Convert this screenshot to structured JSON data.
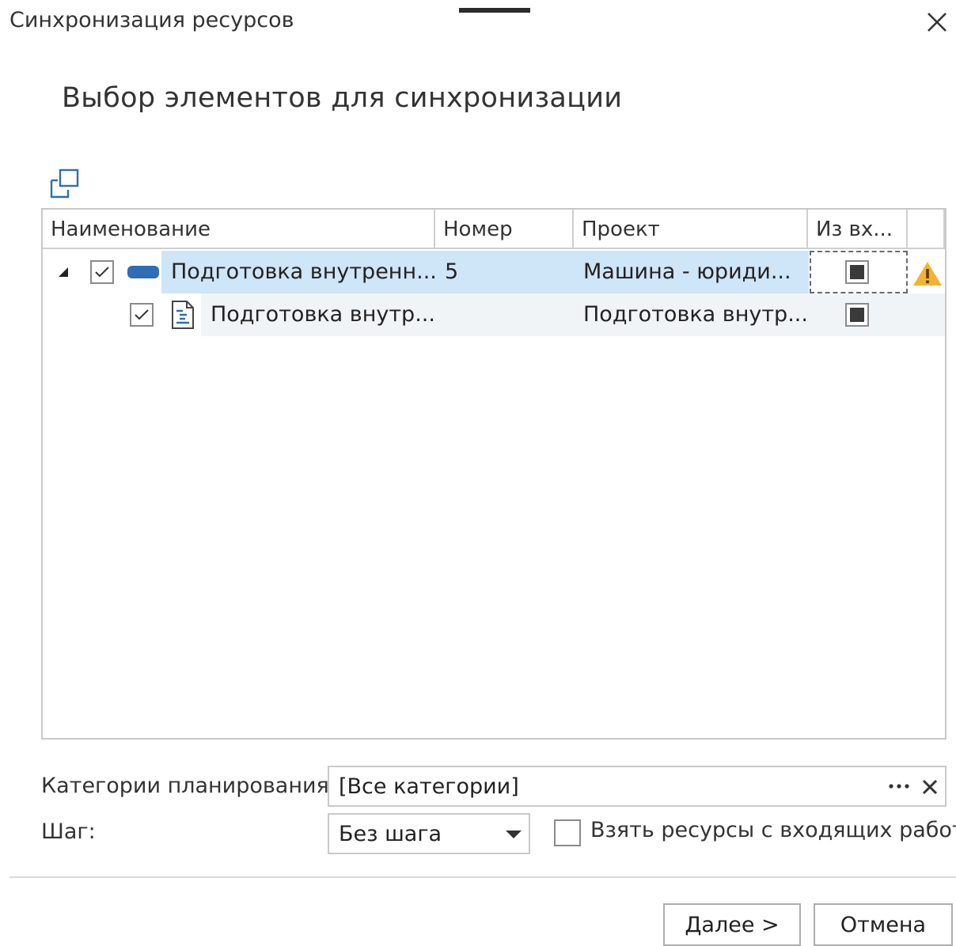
{
  "window": {
    "title": "Синхронизация ресурсов"
  },
  "heading": "Выбор элементов для синхронизации",
  "grid": {
    "columns": [
      "Наименование",
      "Номер",
      "Проект",
      "Из вх..."
    ],
    "rows": [
      {
        "name": "Подготовка внутренн...",
        "number": "5",
        "project": "Машина - юриди...",
        "checked": true,
        "from_incoming": true,
        "warning": true,
        "selected": true
      },
      {
        "name": "Подготовка внутр...",
        "number": "",
        "project": "Подготовка внутр...",
        "checked": true,
        "from_incoming": true,
        "warning": false,
        "selected": false
      }
    ]
  },
  "form": {
    "categories_label": "Категории планирования:",
    "categories_value": "[Все категории]",
    "step_label": "Шаг:",
    "step_value": "Без шага",
    "take_resources_label": "Взять ресурсы с входящих работ",
    "take_resources_checked": false
  },
  "buttons": {
    "next": "Далее >",
    "cancel": "Отмена"
  },
  "colors": {
    "accent": "#2f6db5",
    "selection": "#cfe5f8",
    "warning": "#f2b233"
  },
  "icons": {
    "close": "close-icon",
    "expand": "expand-window-icon",
    "resource": "resource-pill-icon",
    "task": "task-document-icon",
    "warning": "warning-icon",
    "dropdown": "chevron-down-icon"
  }
}
